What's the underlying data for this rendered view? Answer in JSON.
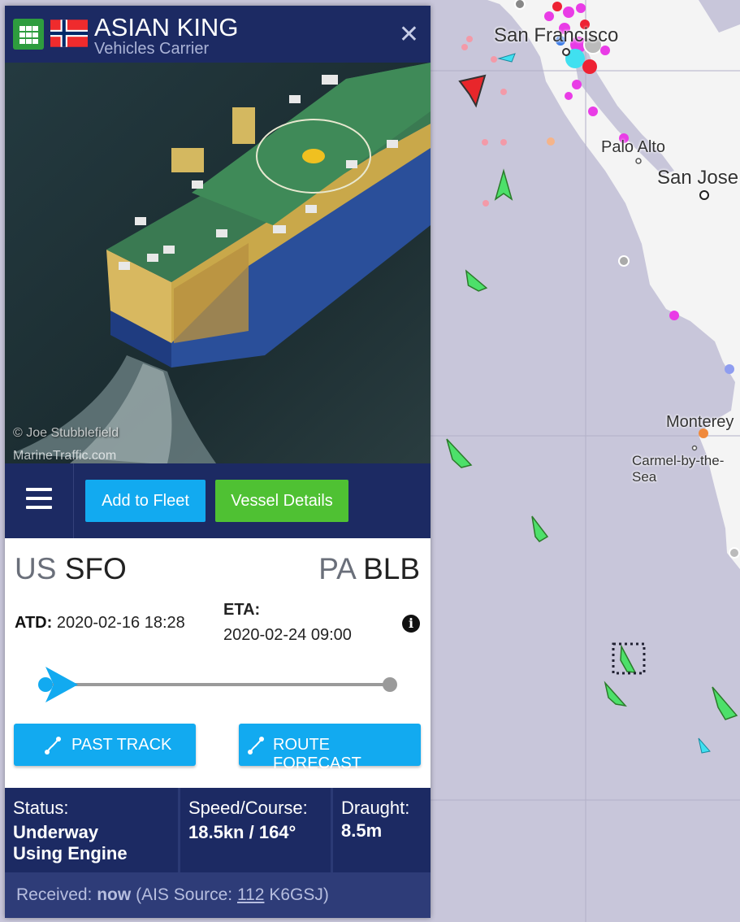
{
  "map": {
    "labels": {
      "san_francisco": "San Francisco",
      "palo_alto": "Palo Alto",
      "san_jose": "San Jose",
      "monterey": "Monterey",
      "carmel": "Carmel-by-the-Sea"
    }
  },
  "vessel": {
    "name": "ASIAN KING",
    "type": "Vehicles Carrier",
    "flag": "Norway",
    "photo_credit": "© Joe Stubblefield",
    "photo_site": "MarineTraffic.com"
  },
  "toolbar": {
    "menu_icon": "hamburger-icon",
    "add_to_fleet": "Add to Fleet",
    "vessel_details": "Vessel Details"
  },
  "voyage": {
    "origin_country": "US",
    "origin_port": "SFO",
    "dest_country": "PA",
    "dest_port": "BLB",
    "atd_label": "ATD:",
    "atd_value": "2020-02-16 18:28",
    "eta_label": "ETA:",
    "eta_value": "2020-02-24 09:00",
    "progress": 0.0
  },
  "actions": {
    "past_track": "PAST TRACK",
    "route_forecast": "ROUTE FORECAST"
  },
  "stats": {
    "status_label": "Status:",
    "status_value_1": "Underway",
    "status_value_2": "Using Engine",
    "speed_label": "Speed/Course:",
    "speed_value": "18.5kn / 164°",
    "draught_label": "Draught:",
    "draught_value": "8.5m"
  },
  "footer": {
    "received_label": "Received:",
    "received_value": "now",
    "source_prefix": "(AIS Source:",
    "source_id": "112",
    "source_suffix": "K6GSJ)"
  },
  "colors": {
    "panel_header": "#1c2a63",
    "accent_blue": "#12aaf0",
    "accent_green": "#4fc133",
    "map_sea": "#c8c6da",
    "map_land": "#f4f4f4"
  }
}
